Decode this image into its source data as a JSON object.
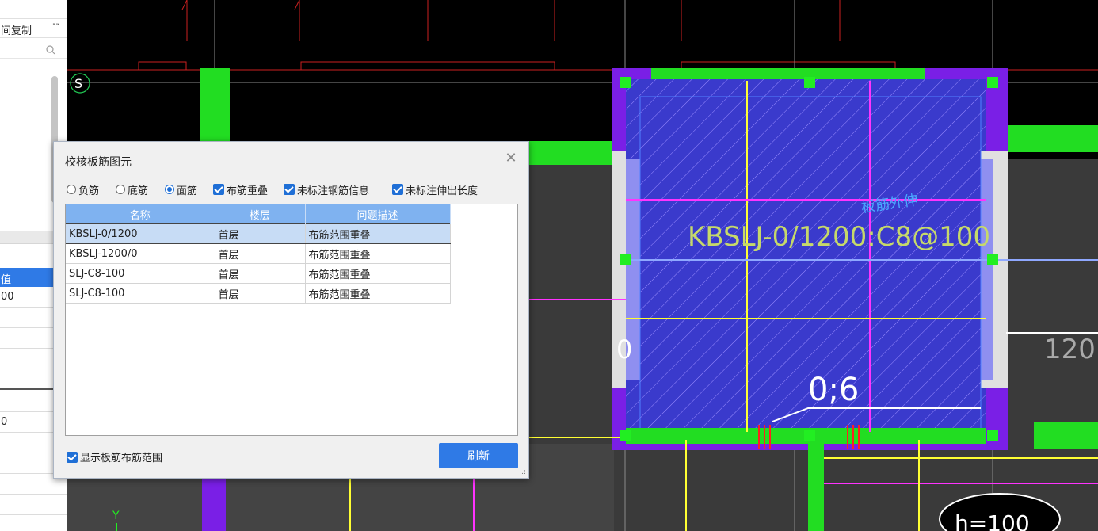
{
  "left_panel": {
    "copy_label": "间复制",
    "more_glyph": "⁍⁍",
    "value_header": "值",
    "values": [
      "00",
      "0"
    ]
  },
  "canvas": {
    "marker_s": "S",
    "rebar_label": "KBSLJ-0/1200:C8@100",
    "extend_label": "板筋外伸",
    "dim_label": "0;6",
    "left_digit": "0",
    "right_number": "120",
    "ellipse_label": "h=100",
    "axis_y": "Y"
  },
  "dialog": {
    "title": "校核板筋图元",
    "close_glyph": "✕",
    "radios": [
      {
        "label": "负筋",
        "checked": false
      },
      {
        "label": "底筋",
        "checked": false
      },
      {
        "label": "面筋",
        "checked": true
      }
    ],
    "checks": [
      {
        "label": "布筋重叠",
        "checked": true
      },
      {
        "label": "未标注钢筋信息",
        "checked": true
      },
      {
        "label": "未标注伸出长度",
        "checked": true
      }
    ],
    "columns": [
      "名称",
      "楼层",
      "问题描述"
    ],
    "rows": [
      {
        "name": "KBSLJ-0/1200",
        "floor": "首层",
        "issue": "布筋范围重叠"
      },
      {
        "name": "KBSLJ-1200/0",
        "floor": "首层",
        "issue": "布筋范围重叠"
      },
      {
        "name": "SLJ-C8-100",
        "floor": "首层",
        "issue": "布筋范围重叠"
      },
      {
        "name": "SLJ-C8-100",
        "floor": "首层",
        "issue": "布筋范围重叠"
      }
    ],
    "show_range_label": "显示板筋布筋范围",
    "refresh_label": "刷新",
    "grip_glyph": ".:"
  },
  "colors": {
    "accent": "#2f7ae6",
    "header": "#7fb2f0",
    "cad_green": "#22dd22",
    "cad_purple": "#7a1fe6",
    "cad_blue_fill": "#3a3acc",
    "cad_yellow": "#ffff33",
    "cad_magenta": "#ff33ff"
  }
}
